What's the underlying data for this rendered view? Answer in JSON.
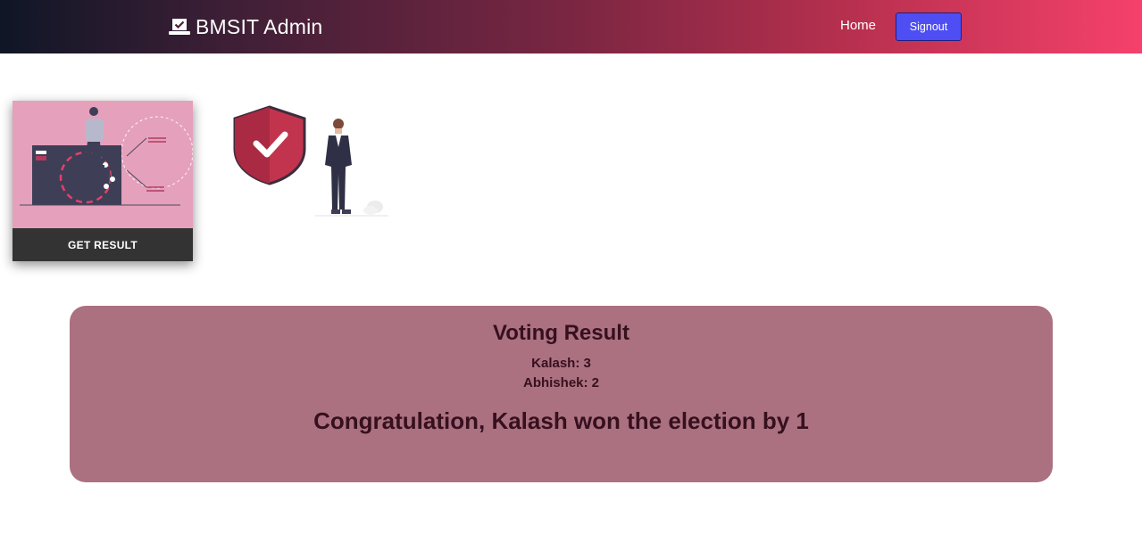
{
  "navbar": {
    "brand": "BMSIT Admin",
    "home_label": "Home",
    "signout_label": "Signout",
    "brand_icon": "laptop-check-icon"
  },
  "card": {
    "button_label": "GET RESULT",
    "image": "person-on-ballot-box-illustration"
  },
  "illustration": {
    "icons": [
      "shield-check-icon",
      "standing-person-illustration"
    ]
  },
  "result": {
    "title": "Voting Result",
    "candidates": [
      {
        "name": "Kalash",
        "votes": 3,
        "text": "Kalash: 3"
      },
      {
        "name": "Abhishek",
        "votes": 2,
        "text": "Abhishek: 2"
      }
    ],
    "message": "Congratulation, Kalash won the election by 1"
  },
  "colors": {
    "nav_gradient_start": "#0f1626",
    "nav_gradient_end": "#f5416b",
    "signout_bg": "#4e4ef4",
    "result_bg": "#ab7180",
    "result_text": "#36101e",
    "card_bg": "#e5a0bc",
    "card_button_bg": "#333333"
  }
}
